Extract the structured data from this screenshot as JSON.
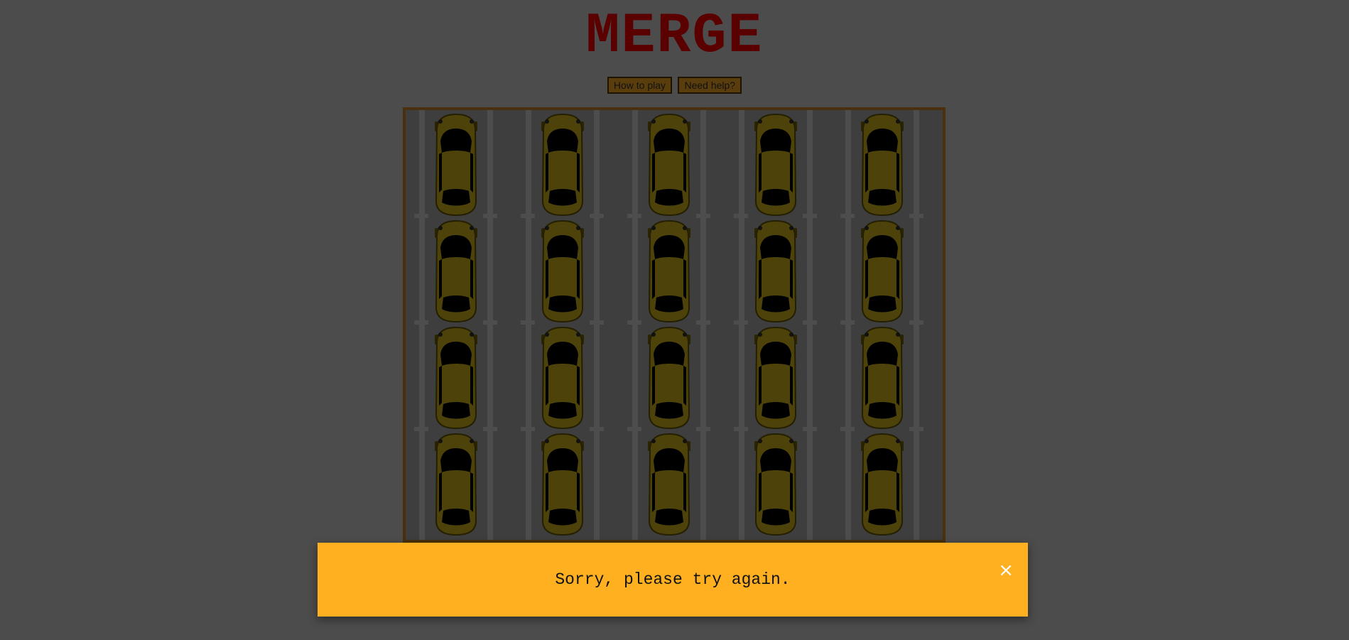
{
  "title": "MERGE",
  "buttons": {
    "how_to_play": "How to play",
    "need_help": "Need help?"
  },
  "board": {
    "columns": 5,
    "rows": 4,
    "car_color": "#4d430a",
    "icon": "yellow-car-icon"
  },
  "toast": {
    "message": "Sorry, please try again.",
    "close_icon": "×",
    "background": "#ffb021"
  }
}
